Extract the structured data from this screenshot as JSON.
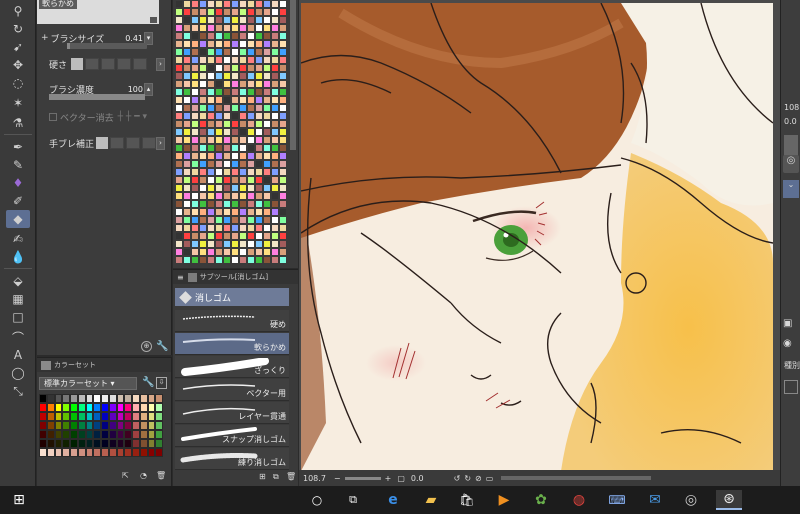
{
  "tool_property": {
    "brush_name": "軟らかめ",
    "brush_size_label": "ブラシサイズ",
    "brush_size_value": "0.41",
    "hardness_label": "硬さ",
    "density_label": "ブラシ濃度",
    "density_value": "100",
    "vector_erase_label": "ベクター消去",
    "stabilization_label": "手ブレ補正"
  },
  "color_set": {
    "panel_title": "カラーセット",
    "set_name": "標準カラーセット"
  },
  "subtool": {
    "panel_title": "サブツール[消しゴム]",
    "category_label": "消しゴム",
    "items": [
      {
        "label": "硬め"
      },
      {
        "label": "軟らかめ"
      },
      {
        "label": "ざっくり"
      },
      {
        "label": "ベクター用"
      },
      {
        "label": "レイヤー貫通"
      },
      {
        "label": "スナップ消しゴム"
      },
      {
        "label": "練り消しゴム"
      }
    ]
  },
  "canvas": {
    "zoom": "108.7",
    "angle": "0.0"
  },
  "right_panel": {
    "zoom_value": "108",
    "rotation_value": "0.0",
    "type_label": "種別"
  },
  "colors": {
    "accent": "#5d6f93",
    "hair": "#a95a2a",
    "skin": "#f7ecdf",
    "blonde": "#f2b43a",
    "eye": "#4aa03a"
  },
  "taskbar": {
    "icons": [
      "windows-start-icon",
      "cortana-icon",
      "task-view-icon",
      "edge-icon",
      "file-explorer-icon",
      "store-icon",
      "media-player-icon",
      "globe-app-icon",
      "chrome-icon",
      "keyboard-app-icon",
      "mail-icon",
      "clip-studio-icon",
      "clip-studio-paint-icon"
    ]
  }
}
